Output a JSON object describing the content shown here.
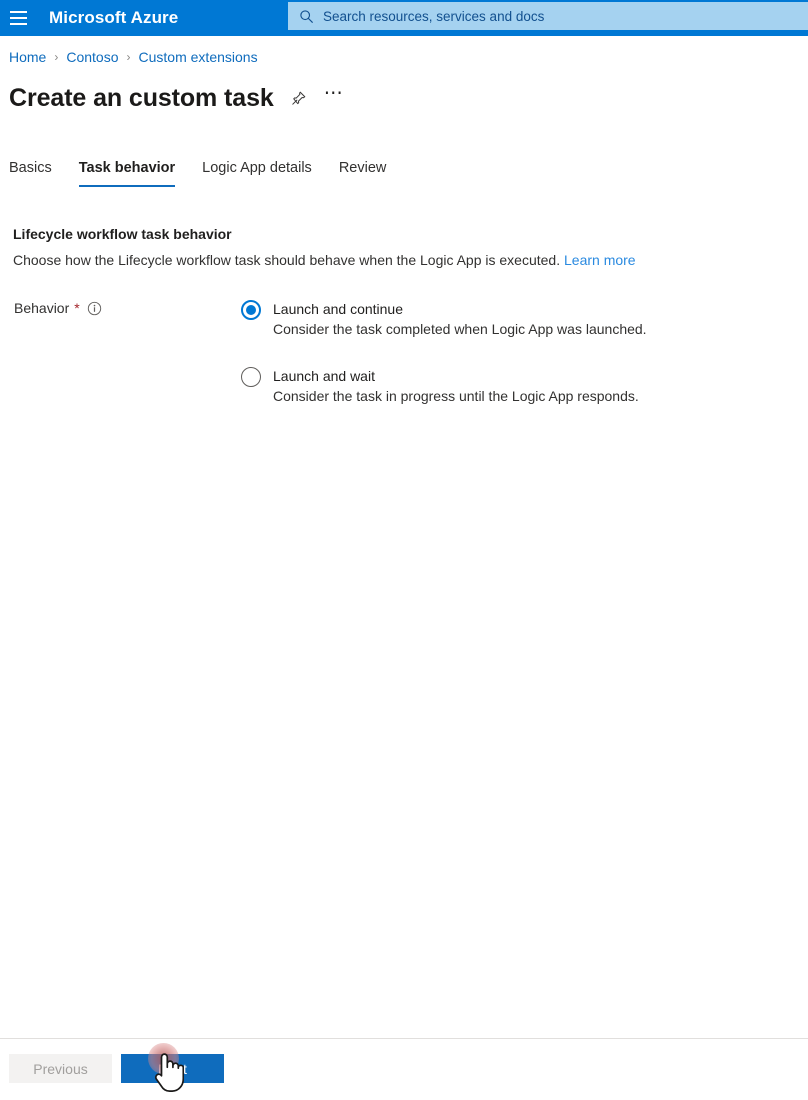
{
  "topbar": {
    "menu_icon": "hamburger-icon",
    "brand": "Microsoft Azure",
    "search": {
      "icon": "search-icon",
      "placeholder": "Search resources, services and docs",
      "value": ""
    },
    "accent_color": "#0078d4",
    "search_bg_color": "#a5d2f0"
  },
  "breadcrumb": {
    "separator": "›",
    "items": [
      {
        "label": "Home"
      },
      {
        "label": "Contoso"
      },
      {
        "label": "Custom extensions"
      }
    ],
    "link_color": "#0f6cbd"
  },
  "header": {
    "title": "Create an custom task",
    "pin_icon": "pin-icon",
    "more_icon": "ellipsis-icon",
    "more_label": "⋯"
  },
  "tabs": {
    "items": [
      {
        "label": "Basics",
        "active": false
      },
      {
        "label": "Task behavior",
        "active": true
      },
      {
        "label": "Logic App details",
        "active": false
      },
      {
        "label": "Review",
        "active": false
      }
    ],
    "active_underline_color": "#0f6cbd"
  },
  "main": {
    "section_title": "Lifecycle workflow task behavior",
    "section_description": "Choose how the Lifecycle workflow task should behave when the Logic App is executed.",
    "learn_more_label": "Learn more",
    "field": {
      "label": "Behavior",
      "required_marker": "*",
      "info_icon": "info-icon",
      "info_glyph": "i",
      "required_color": "#a4262c"
    },
    "radio_options": [
      {
        "title": "Launch and continue",
        "description": "Consider the task completed when Logic App was launched.",
        "selected": true
      },
      {
        "title": "Launch and wait",
        "description": "Consider the task in progress until the Logic App responds.",
        "selected": false
      }
    ],
    "radio_selected_color": "#0078d4"
  },
  "footer": {
    "previous_label": "Previous",
    "next_label": "Next",
    "next_color": "#0f6cbd",
    "previous_disabled": true
  },
  "cursor": {
    "icon": "hand-pointer-cursor",
    "click_indicator": "click-ripple"
  }
}
